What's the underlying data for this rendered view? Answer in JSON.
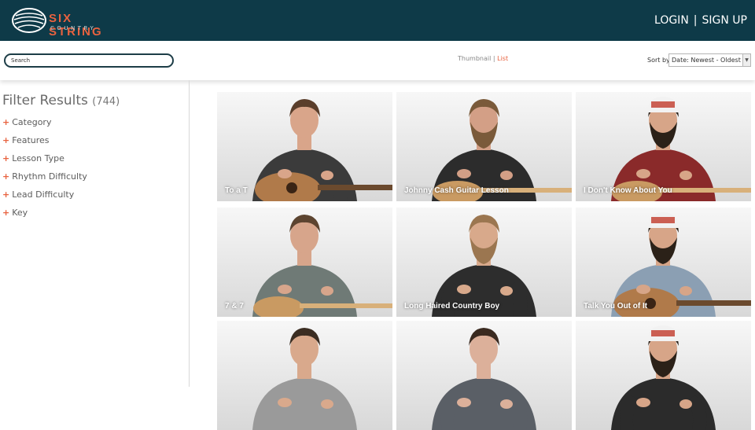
{
  "header": {
    "logo_title": "SIX STRING",
    "logo_subtitle": "COUNTRY",
    "login_label": "LOGIN",
    "separator": "|",
    "signup_label": "SIGN UP"
  },
  "toolbar": {
    "search_placeholder": "Search",
    "view_thumbnail": "Thumbnail",
    "view_separator": "|",
    "view_list": "List",
    "sort_label": "Sort by",
    "sort_value": "Date: Newest - Oldest"
  },
  "sidebar": {
    "title": "Filter Results",
    "count": "(744)",
    "filters": [
      {
        "label": "Category"
      },
      {
        "label": "Features"
      },
      {
        "label": "Lesson Type"
      },
      {
        "label": "Rhythm Difficulty"
      },
      {
        "label": "Lead Difficulty"
      },
      {
        "label": "Key"
      }
    ]
  },
  "lessons": [
    {
      "title": "To a T",
      "shirt": "#3b3b3b",
      "skin": "#d9a58a",
      "hair": "#5a3e2b",
      "beard": false,
      "cap": false,
      "guitar": "acoustic"
    },
    {
      "title": "Johnny Cash Guitar Lesson",
      "shirt": "#2c2c2c",
      "skin": "#d39f86",
      "hair": "#7a5a3a",
      "beard": true,
      "cap": false,
      "guitar": "electric"
    },
    {
      "title": "I Don't Know About You",
      "shirt": "#8a2a2a",
      "skin": "#d7a588",
      "hair": "#2b2118",
      "beard": true,
      "cap": true,
      "guitar": "electric"
    },
    {
      "title": "7 & 7",
      "shirt": "#6f7a76",
      "skin": "#d7a58b",
      "hair": "#5c4430",
      "beard": false,
      "cap": false,
      "guitar": "electric"
    },
    {
      "title": "Long Haired Country Boy",
      "shirt": "#2d2d2d",
      "skin": "#d8a98b",
      "hair": "#9b7650",
      "beard": true,
      "cap": false,
      "guitar": "none"
    },
    {
      "title": "Talk You Out of It",
      "shirt": "#8b9fb3",
      "skin": "#d7a588",
      "hair": "#2b2118",
      "beard": true,
      "cap": true,
      "guitar": "acoustic"
    },
    {
      "title": "",
      "shirt": "#9a9a9a",
      "skin": "#d9a98c",
      "hair": "#3b2d22",
      "beard": false,
      "cap": false,
      "guitar": "none"
    },
    {
      "title": "",
      "shirt": "#5a5f66",
      "skin": "#dcb09a",
      "hair": "#3a2a20",
      "beard": false,
      "cap": false,
      "guitar": "none"
    },
    {
      "title": "",
      "shirt": "#2b2b2b",
      "skin": "#d7a588",
      "hair": "#2b2118",
      "beard": true,
      "cap": true,
      "guitar": "none"
    }
  ],
  "colors": {
    "header_bg": "#0e3a48",
    "accent": "#e8623f"
  }
}
